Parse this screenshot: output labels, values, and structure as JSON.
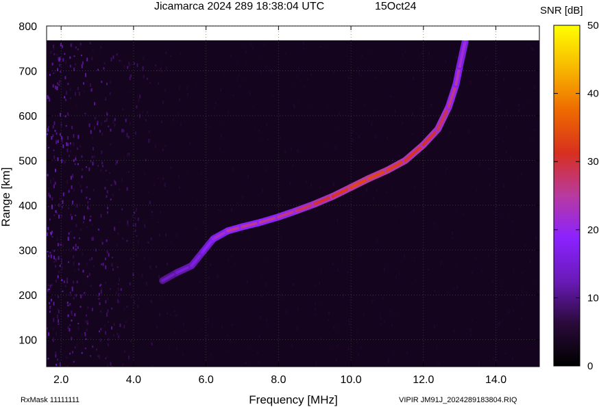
{
  "header": {
    "title": "Jicamarca 2024 289 18:38:04 UTC",
    "date": "15Oct24"
  },
  "footer": {
    "rxmask": "RxMask 11111111",
    "filename": "VIPIR  JM91J_2024289183804.RIQ"
  },
  "colorbar": {
    "title": "SNR [dB]",
    "ticks": [
      "50",
      "40",
      "30",
      "20",
      "10",
      "0"
    ],
    "range": [
      0,
      50
    ],
    "stops": [
      "#000000",
      "#2a0a3a",
      "#6a1ab8",
      "#8a22ff",
      "#b83aa0",
      "#d8301e",
      "#ee6a00",
      "#f8b800",
      "#ffff00"
    ]
  },
  "chart_data": {
    "type": "heatmap",
    "title": "Jicamarca 2024 289 18:38:04 UTC",
    "xlabel": "Frequency [MHz]",
    "ylabel": "Range [km]",
    "xlim": [
      1.6,
      15.2
    ],
    "ylim": [
      40,
      800
    ],
    "xticks": [
      "2.0",
      "4.0",
      "6.0",
      "8.0",
      "10.0",
      "12.0",
      "14.0"
    ],
    "yticks": [
      "800",
      "700",
      "600",
      "500",
      "400",
      "300",
      "200",
      "100"
    ],
    "grid": true,
    "background_noise_snr_db": 3,
    "series": [
      {
        "name": "",
        "points": [
          {
            "x": 4.8,
            "y": 232,
            "snr": 13
          },
          {
            "x": 5.2,
            "y": 250,
            "snr": 15
          },
          {
            "x": 5.6,
            "y": 265,
            "snr": 16
          },
          {
            "x": 5.9,
            "y": 295,
            "snr": 17
          },
          {
            "x": 6.2,
            "y": 325,
            "snr": 20
          },
          {
            "x": 6.6,
            "y": 343,
            "snr": 25
          },
          {
            "x": 7.0,
            "y": 352,
            "snr": 26
          },
          {
            "x": 7.5,
            "y": 362,
            "snr": 25
          },
          {
            "x": 8.0,
            "y": 374,
            "snr": 26
          },
          {
            "x": 8.5,
            "y": 388,
            "snr": 27
          },
          {
            "x": 9.0,
            "y": 403,
            "snr": 30
          },
          {
            "x": 9.5,
            "y": 420,
            "snr": 31
          },
          {
            "x": 10.0,
            "y": 440,
            "snr": 33
          },
          {
            "x": 10.5,
            "y": 460,
            "snr": 34
          },
          {
            "x": 11.0,
            "y": 478,
            "snr": 33
          },
          {
            "x": 11.5,
            "y": 500,
            "snr": 32
          },
          {
            "x": 12.0,
            "y": 535,
            "snr": 31
          },
          {
            "x": 12.4,
            "y": 570,
            "snr": 30
          },
          {
            "x": 12.7,
            "y": 620,
            "snr": 28
          },
          {
            "x": 12.9,
            "y": 670,
            "snr": 25
          },
          {
            "x": 13.0,
            "y": 710,
            "snr": 23
          },
          {
            "x": 13.15,
            "y": 765,
            "snr": 20
          }
        ]
      }
    ]
  }
}
